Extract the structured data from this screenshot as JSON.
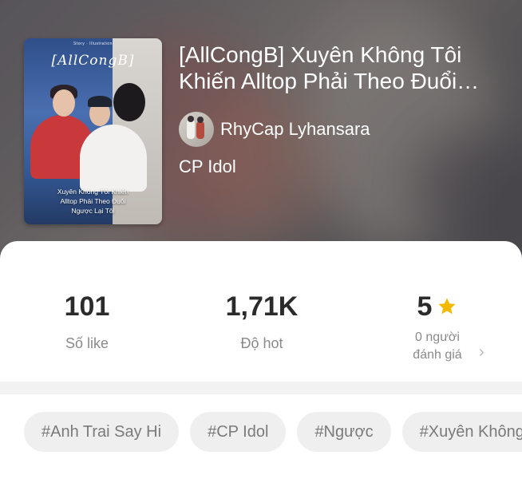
{
  "story": {
    "cover": {
      "tag_line": "Story · Illustration",
      "logo": "[AllCongB]",
      "caption_lines": [
        "Xuyên Không Tôi Khiến",
        "Alltop Phải Theo Đuổi",
        "Ngược Lại Tôi"
      ]
    },
    "title": "[AllCongB] Xuyên Không Tôi Khiến Alltop Phải Theo Đuổi Ngược Lại Tôi",
    "author": "RhyCap Lyhansara",
    "category": "CP Idol"
  },
  "stats": {
    "likes_value": "101",
    "likes_label": "Số like",
    "hot_value": "1,71K",
    "hot_label": "Độ hot",
    "rating_value": "5",
    "rating_count_line1": "0 người",
    "rating_count_line2": "đánh giá"
  },
  "tags": [
    "#Anh Trai Say Hi",
    "#CP Idol",
    "#Ngược",
    "#Xuyên Không"
  ],
  "colors": {
    "star": "#f5b800",
    "text_primary": "#2b2b2b",
    "text_muted": "#8a8a8a",
    "tag_bg": "#efefef"
  },
  "icons": {
    "rating": "star-icon",
    "more": "chevron-right-icon"
  }
}
